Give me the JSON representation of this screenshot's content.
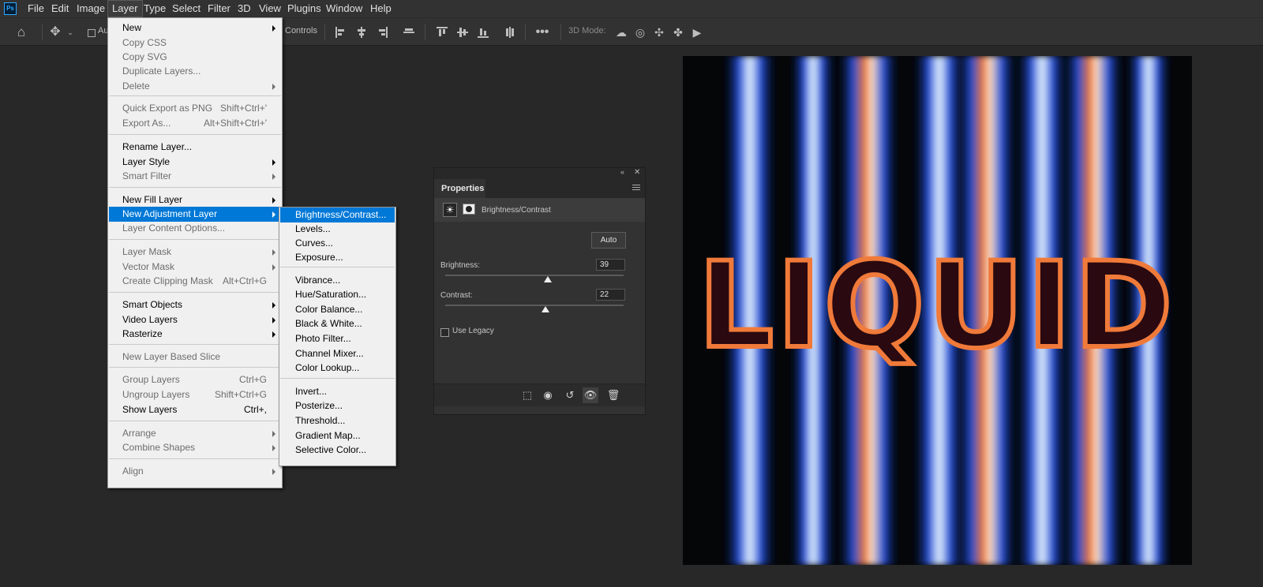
{
  "app": {
    "logo": "Ps"
  },
  "menubar": {
    "items": [
      "File",
      "Edit",
      "Image",
      "Layer",
      "Type",
      "Select",
      "Filter",
      "3D",
      "View",
      "Plugins",
      "Window",
      "Help"
    ]
  },
  "optionsbar": {
    "auto_label": "Au",
    "controls_label": "Controls",
    "mode_3d_label": "3D Mode:",
    "icons": [
      "home-icon",
      "move-tool-icon",
      "align-icons",
      "more-icon",
      "orbit-3d-icon",
      "roll-3d-icon",
      "pan-3d-icon",
      "slide-3d-icon",
      "scale-3d-icon"
    ]
  },
  "layer_menu": {
    "items": [
      {
        "label": "New",
        "shortcut": "",
        "submenu": true,
        "disabled": false
      },
      {
        "label": "Copy CSS",
        "shortcut": "",
        "submenu": false,
        "disabled": true
      },
      {
        "label": "Copy SVG",
        "shortcut": "",
        "submenu": false,
        "disabled": true
      },
      {
        "label": "Duplicate Layers...",
        "shortcut": "",
        "submenu": false,
        "disabled": true
      },
      {
        "label": "Delete",
        "shortcut": "",
        "submenu": true,
        "disabled": true
      },
      {
        "label": "Quick Export as PNG",
        "shortcut": "Shift+Ctrl+'",
        "submenu": false,
        "disabled": true
      },
      {
        "label": "Export As...",
        "shortcut": "Alt+Shift+Ctrl+'",
        "submenu": false,
        "disabled": true
      },
      {
        "label": "Rename Layer...",
        "shortcut": "",
        "submenu": false,
        "disabled": false
      },
      {
        "label": "Layer Style",
        "shortcut": "",
        "submenu": true,
        "disabled": false
      },
      {
        "label": "Smart Filter",
        "shortcut": "",
        "submenu": true,
        "disabled": true
      },
      {
        "label": "New Fill Layer",
        "shortcut": "",
        "submenu": true,
        "disabled": false
      },
      {
        "label": "New Adjustment Layer",
        "shortcut": "",
        "submenu": true,
        "disabled": false,
        "highlighted": true
      },
      {
        "label": "Layer Content Options...",
        "shortcut": "",
        "submenu": false,
        "disabled": true
      },
      {
        "label": "Layer Mask",
        "shortcut": "",
        "submenu": true,
        "disabled": true
      },
      {
        "label": "Vector Mask",
        "shortcut": "",
        "submenu": true,
        "disabled": true
      },
      {
        "label": "Create Clipping Mask",
        "shortcut": "Alt+Ctrl+G",
        "submenu": false,
        "disabled": true
      },
      {
        "label": "Smart Objects",
        "shortcut": "",
        "submenu": true,
        "disabled": false
      },
      {
        "label": "Video Layers",
        "shortcut": "",
        "submenu": true,
        "disabled": false
      },
      {
        "label": "Rasterize",
        "shortcut": "",
        "submenu": true,
        "disabled": false
      },
      {
        "label": "New Layer Based Slice",
        "shortcut": "",
        "submenu": false,
        "disabled": true
      },
      {
        "label": "Group Layers",
        "shortcut": "Ctrl+G",
        "submenu": false,
        "disabled": true
      },
      {
        "label": "Ungroup Layers",
        "shortcut": "Shift+Ctrl+G",
        "submenu": false,
        "disabled": true
      },
      {
        "label": "Show Layers",
        "shortcut": "Ctrl+,",
        "submenu": false,
        "disabled": false
      },
      {
        "label": "Arrange",
        "shortcut": "",
        "submenu": true,
        "disabled": true
      },
      {
        "label": "Combine Shapes",
        "shortcut": "",
        "submenu": true,
        "disabled": true
      },
      {
        "label": "Align",
        "shortcut": "",
        "submenu": true,
        "disabled": true
      }
    ]
  },
  "adjustment_submenu": {
    "items": [
      {
        "label": "Brightness/Contrast...",
        "highlighted": true
      },
      {
        "label": "Levels..."
      },
      {
        "label": "Curves..."
      },
      {
        "label": "Exposure..."
      },
      {
        "label": "Vibrance..."
      },
      {
        "label": "Hue/Saturation..."
      },
      {
        "label": "Color Balance..."
      },
      {
        "label": "Black & White..."
      },
      {
        "label": "Photo Filter..."
      },
      {
        "label": "Channel Mixer..."
      },
      {
        "label": "Color Lookup..."
      },
      {
        "label": "Invert..."
      },
      {
        "label": "Posterize..."
      },
      {
        "label": "Threshold..."
      },
      {
        "label": "Gradient Map..."
      },
      {
        "label": "Selective Color..."
      }
    ]
  },
  "properties": {
    "tab": "Properties",
    "adjustment_name": "Brightness/Contrast",
    "auto_label": "Auto",
    "brightness_label": "Brightness:",
    "brightness_value": "39",
    "brightness_fraction": 0.575,
    "contrast_label": "Contrast:",
    "contrast_value": "22",
    "contrast_fraction": 0.56,
    "use_legacy_label": "Use Legacy",
    "use_legacy_checked": false,
    "footer_icons": [
      "clip-to-layer-icon",
      "view-previous-state-icon",
      "reset-icon",
      "toggle-visibility-icon",
      "delete-icon"
    ]
  },
  "canvas": {
    "artwork_text": "LIQUID",
    "colors": {
      "background": "#050608",
      "blue": "#1d4bd6",
      "light_blue": "#8fc8ff",
      "orange": "#f07a3a",
      "letter_fill": "#2a0a10"
    }
  },
  "colors": {
    "highlight": "#0078d7",
    "menu_bg": "#f0f0f0",
    "app_bg": "#282828"
  }
}
